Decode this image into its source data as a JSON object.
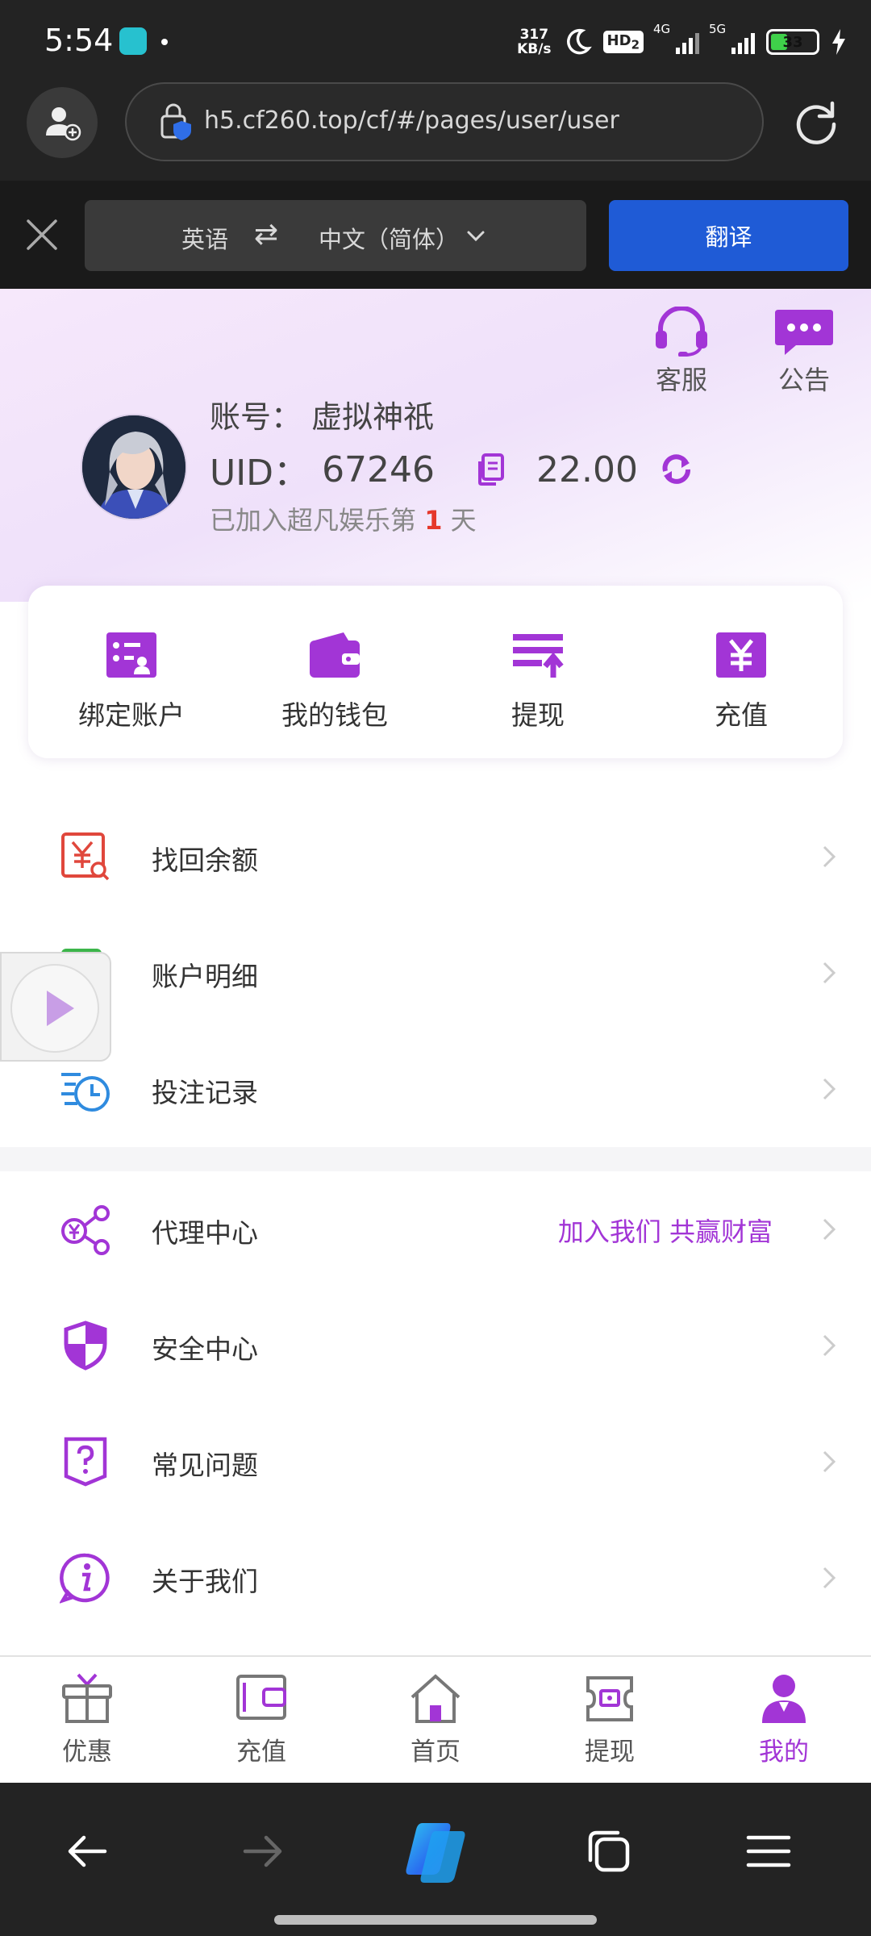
{
  "status_bar": {
    "time": "5:54",
    "net_speed_value": "317",
    "net_speed_unit": "KB/s",
    "hd_label": "HD",
    "hd_sub": "2",
    "sig1_label": "4G",
    "sig2_label": "5G",
    "battery": "33"
  },
  "browser": {
    "url": "h5.cf260.top/cf/#/pages/user/user"
  },
  "translate": {
    "source_lang": "英语",
    "target_lang": "中文（简体）",
    "button": "翻译"
  },
  "header": {
    "service_label": "客服",
    "notice_label": "公告",
    "account_prefix": "账号：",
    "account_name": "虚拟神祇",
    "uid_prefix": "UID：",
    "uid": "67246",
    "balance": "22.00",
    "days_prefix": "已加入超凡娱乐第",
    "days": "1",
    "days_suffix": "天"
  },
  "quick_actions": [
    {
      "label": "绑定账户"
    },
    {
      "label": "我的钱包"
    },
    {
      "label": "提现"
    },
    {
      "label": "充值"
    }
  ],
  "menu": [
    {
      "label": "找回余额"
    },
    {
      "label": "账户明细"
    },
    {
      "label": "投注记录"
    },
    {
      "label": "代理中心",
      "extra": "加入我们 共赢财富"
    },
    {
      "label": "安全中心"
    },
    {
      "label": "常见问题"
    },
    {
      "label": "关于我们"
    }
  ],
  "bottom_nav": [
    {
      "label": "优惠"
    },
    {
      "label": "充值"
    },
    {
      "label": "首页"
    },
    {
      "label": "提现"
    },
    {
      "label": "我的",
      "active": true
    }
  ],
  "colors": {
    "accent": "#a235d6",
    "translate_button": "#1f5bd6",
    "days_number": "#e5382b"
  }
}
